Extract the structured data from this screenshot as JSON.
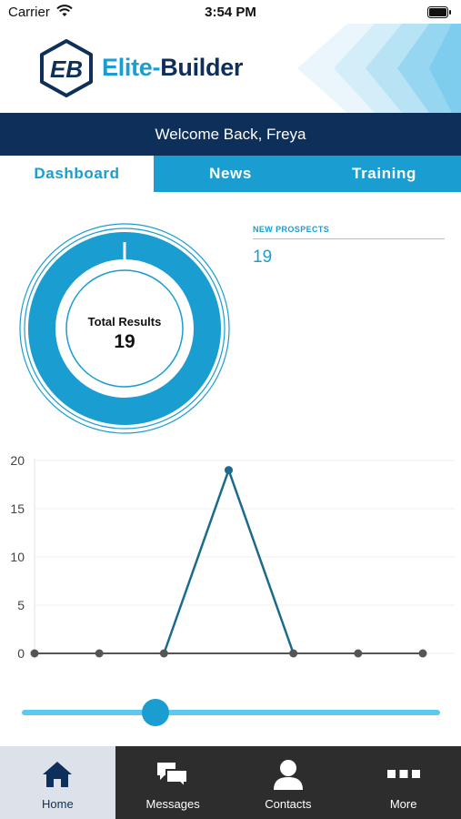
{
  "status_bar": {
    "carrier": "Carrier",
    "time": "3:54 PM"
  },
  "brand": {
    "badge_text": "EB",
    "name_part1": "Elite-",
    "name_part2": "Builder"
  },
  "welcome": "Welcome Back, Freya",
  "tabs": [
    {
      "label": "Dashboard",
      "active": true
    },
    {
      "label": "News",
      "active": false
    },
    {
      "label": "Training",
      "active": false
    }
  ],
  "summary": {
    "total_label": "Total Results",
    "total_value": "19"
  },
  "prospects": {
    "title": "NEW PROSPECTS",
    "value": "19"
  },
  "chart_data": {
    "type": "line",
    "x": [
      0,
      1,
      2,
      3,
      4,
      5,
      6
    ],
    "series": [
      {
        "values": [
          0,
          0,
          0,
          19,
          0,
          0,
          0
        ],
        "color": "#1a6b8c"
      }
    ],
    "y_ticks": [
      0,
      5,
      10,
      15,
      20
    ],
    "ylim": [
      0,
      20
    ],
    "grid": true
  },
  "slider": {
    "value": 0.32
  },
  "bottom_nav": [
    {
      "label": "Home",
      "icon": "home-icon",
      "active": true
    },
    {
      "label": "Messages",
      "icon": "messages-icon",
      "active": false
    },
    {
      "label": "Contacts",
      "icon": "contacts-icon",
      "active": false
    },
    {
      "label": "More",
      "icon": "more-icon",
      "active": false
    }
  ],
  "colors": {
    "primary": "#1a9dd0",
    "navy": "#0e2f5a",
    "nav_bg": "#2d2d2d",
    "nav_active": "#dde2ea"
  }
}
